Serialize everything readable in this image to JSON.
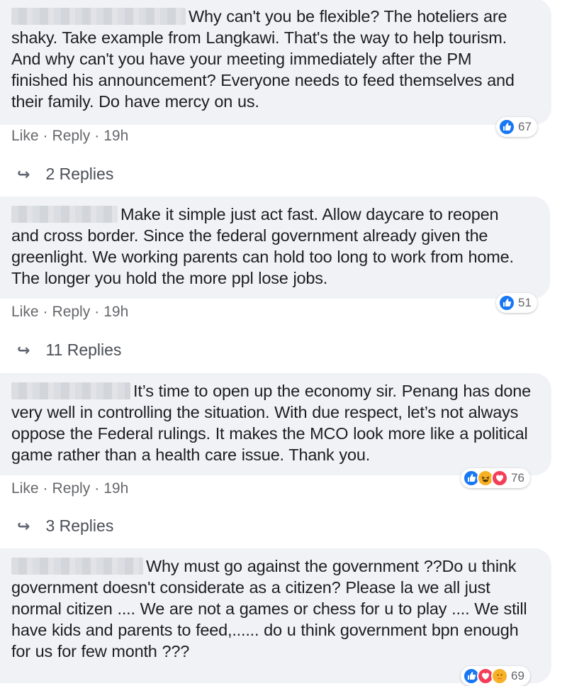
{
  "comments": [
    {
      "text": "Why can't you be flexible? The hoteliers are shaky. Take example from Langkawi. That's the way to help tourism. And why can't you have your meeting immediately after the PM finished his announcement? Everyone needs to feed themselves and their family. Do have mercy on us.",
      "like": "Like",
      "reply": "Reply",
      "time": "19h",
      "reactions": [
        "like-icon"
      ],
      "reaction_count": "67",
      "replies": "2 Replies"
    },
    {
      "text": "Make it simple just act fast. Allow daycare to reopen and cross border. Since the federal government already given the greenlight. We working parents can hold too long to work from home. The longer you hold the more ppl lose jobs.",
      "like": "Like",
      "reply": "Reply",
      "time": "19h",
      "reactions": [
        "like-icon"
      ],
      "reaction_count": "51",
      "replies": "11 Replies"
    },
    {
      "text": "It’s time to open up the economy sir. Penang has done very well in controlling the situation. With due respect, let’s not always oppose the Federal rulings. It makes the MCO look more like a political game rather than a health care issue. Thank you.",
      "like": "Like",
      "reply": "Reply",
      "time": "19h",
      "reactions": [
        "like-icon",
        "haha-icon",
        "love-icon"
      ],
      "reaction_count": "76",
      "replies": "3 Replies"
    },
    {
      "text": "Why must go against the government ??Do u think government doesn't considerate as a citizen? Please la we all just normal citizen .... We are not a games or chess for u to play .... We still have kids and parents to feed,...... do u think government bpn enough for us for few month ???",
      "reactions": [
        "like-icon",
        "love-icon",
        "care-icon"
      ],
      "reaction_count": "69"
    }
  ],
  "colors": {
    "bubble": "#f0f2f5",
    "like": "#1877f2",
    "haha": "#f7b125",
    "love": "#f33e58",
    "meta": "#65676b"
  }
}
